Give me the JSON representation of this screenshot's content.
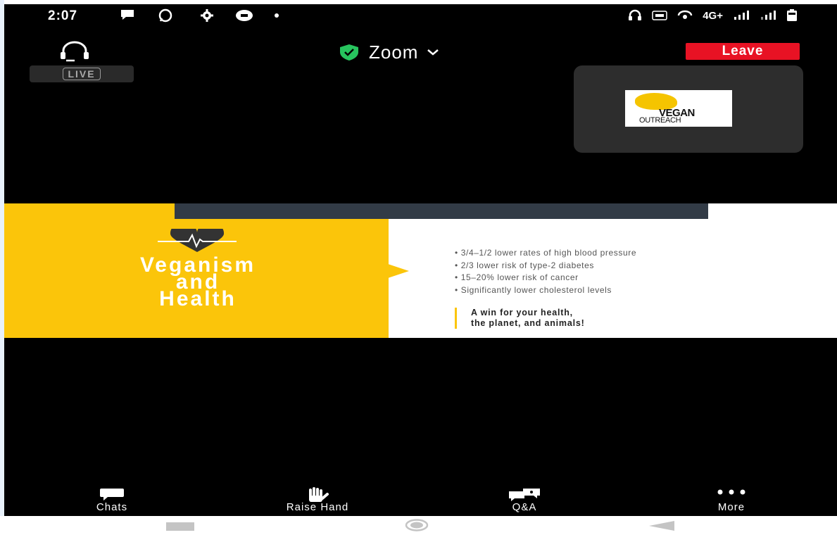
{
  "status_bar": {
    "time": "2:07",
    "network": "4G+",
    "icons_left": [
      "message-icon",
      "whatsapp-icon",
      "settings-icon",
      "game-icon",
      "dot-icon"
    ],
    "icons_right": [
      "headset-icon",
      "volte-icon",
      "hotspot-icon",
      "signal-icon",
      "signal-icon",
      "battery-icon"
    ]
  },
  "header": {
    "title": "Zoom",
    "leave_label": "Leave",
    "live_label": "LIVE",
    "security_color": "#27c45e",
    "leave_color": "#e81224"
  },
  "participant": {
    "logo_text_1": "VEGAN",
    "logo_text_2": "OUTREACH"
  },
  "slide": {
    "title_line1": "Veganism",
    "title_line2": "and",
    "title_line3": "Health",
    "accent_color": "#fbc50a",
    "bullets": [
      "3/4–1/2 lower rates of high blood pressure",
      "2/3 lower risk of type-2 diabetes",
      "15–20% lower risk of cancer",
      "Significantly lower cholesterol levels"
    ],
    "tagline_line1": "A win for your health,",
    "tagline_line2": "the planet, and animals!"
  },
  "toolbar": {
    "chats": "Chats",
    "raise_hand": "Raise Hand",
    "qa": "Q&A",
    "more": "More"
  }
}
